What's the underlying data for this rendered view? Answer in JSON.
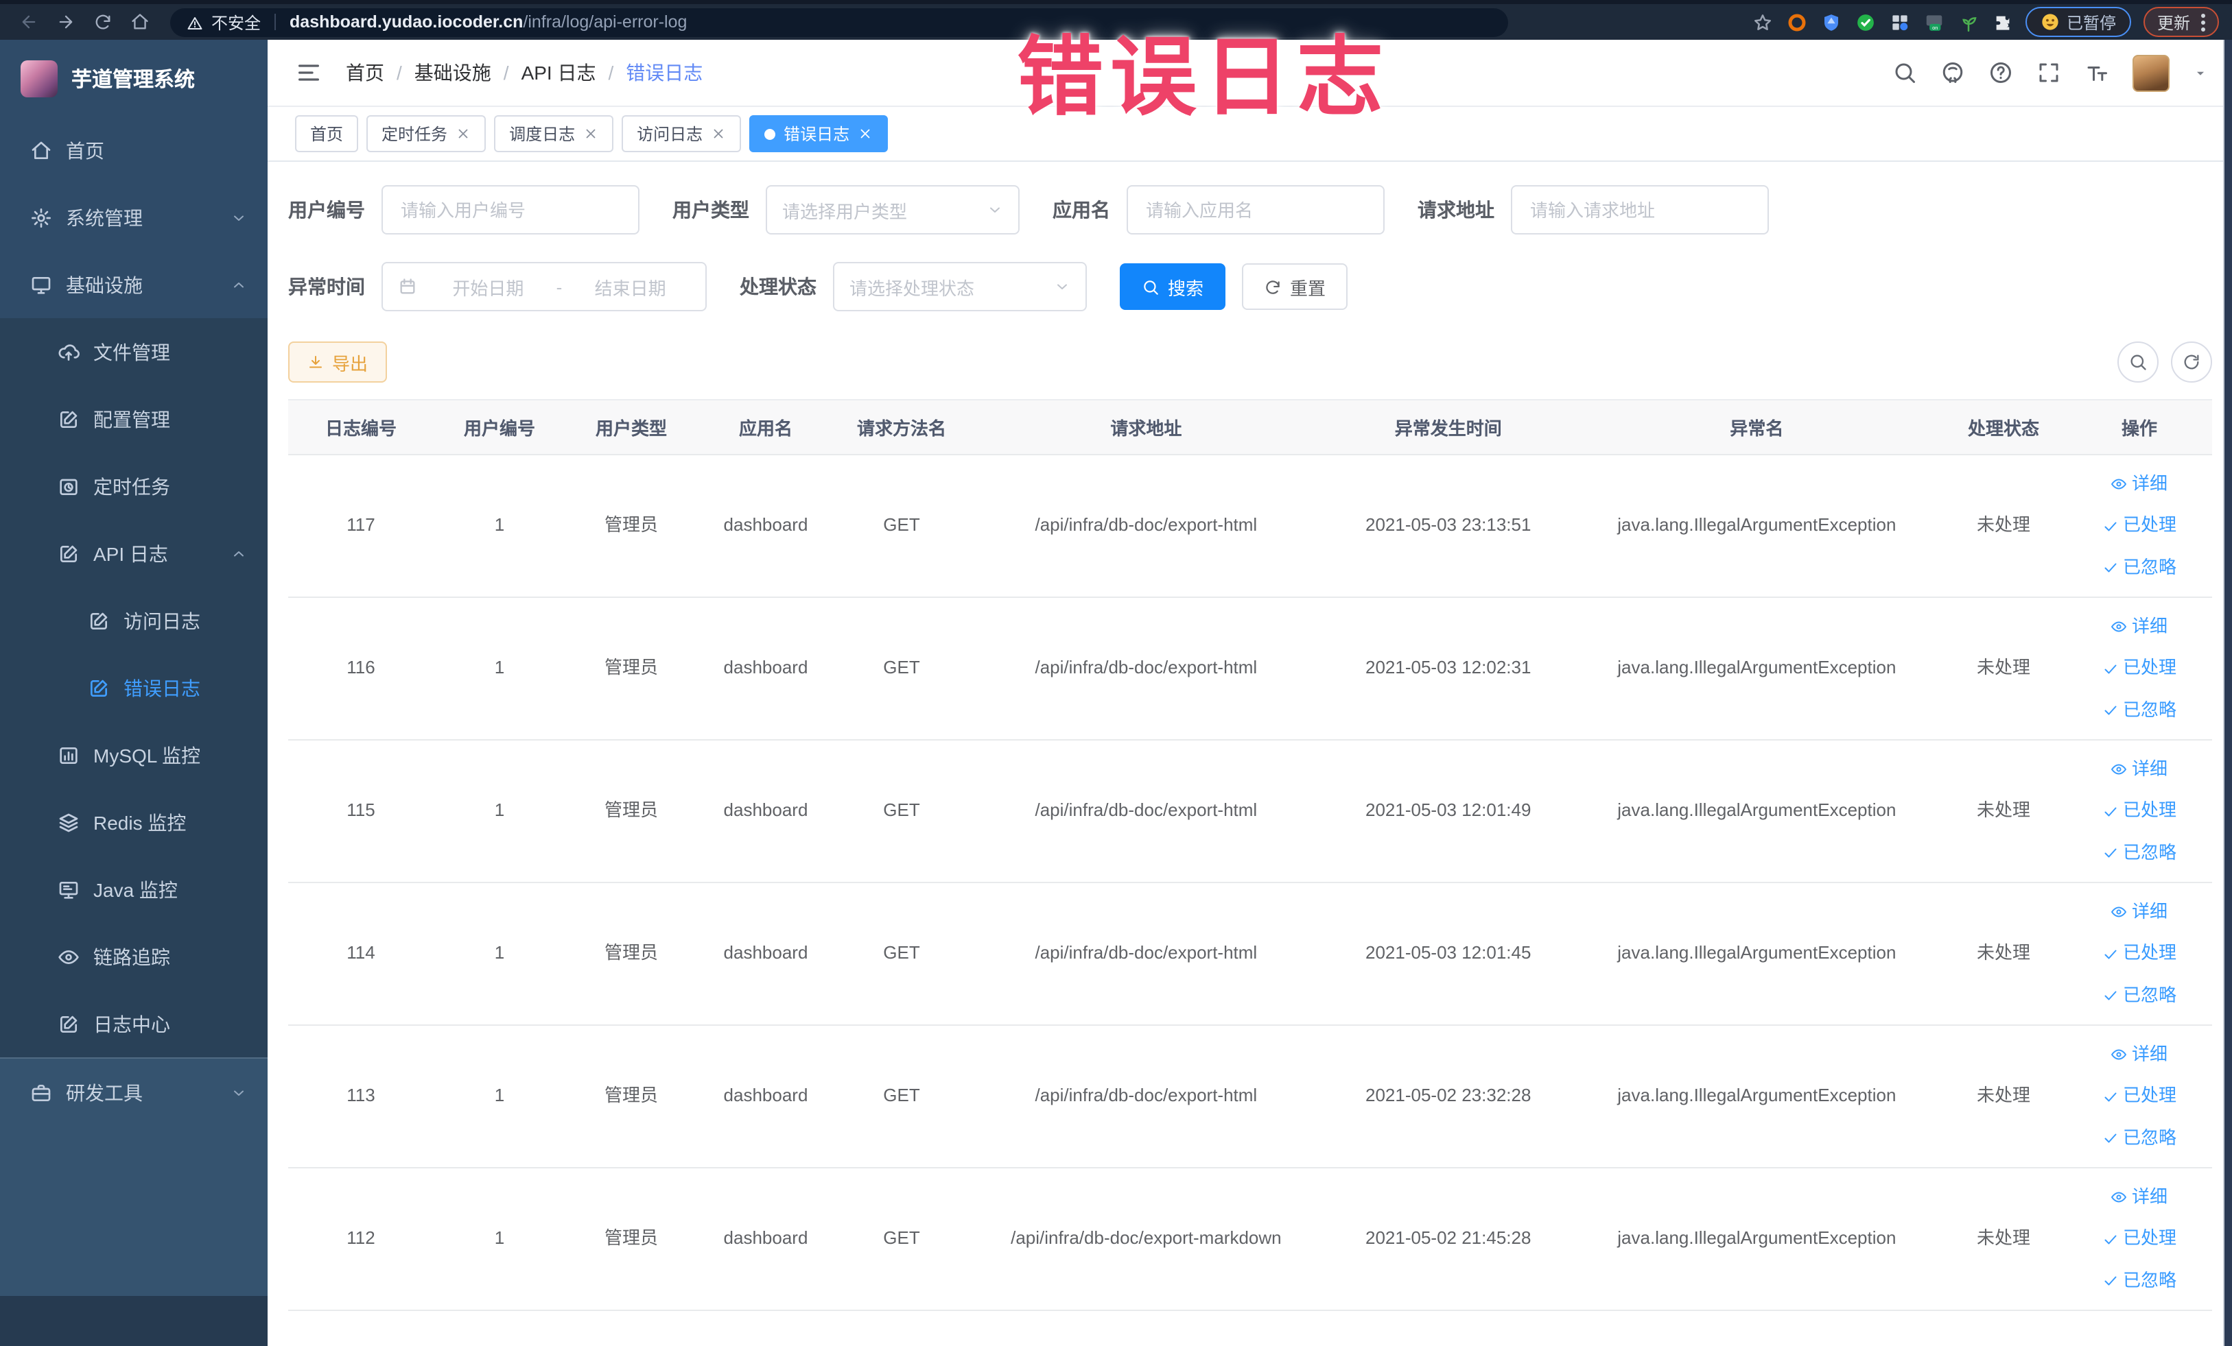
{
  "annotation": {
    "text": "错误日志",
    "color": "#ee4268"
  },
  "browser": {
    "security_label": "不安全",
    "url_host": "dashboard.yudao.iocoder.cn",
    "url_path": "/infra/log/api-error-log",
    "paused_chip_label": "已暂停",
    "update_button_label": "更新",
    "nav_icons": [
      "back-icon",
      "forward-icon",
      "reload-icon",
      "home-icon"
    ],
    "extension_icons": [
      {
        "name": "bookmark-star-icon",
        "color": "#9aa3b2"
      },
      {
        "name": "adblock-ring-icon",
        "color": "#e8710a"
      },
      {
        "name": "shield-icon",
        "color": "#4a8cf7"
      },
      {
        "name": "green-check-extension-icon",
        "color": "#23b34a"
      },
      {
        "name": "apps-grid-icon",
        "color": "#cfd5de"
      },
      {
        "name": "switch-on-icon",
        "color": "#18a05e"
      },
      {
        "name": "sprout-icon",
        "color": "#4caf50"
      },
      {
        "name": "extensions-puzzle-icon",
        "color": "#e8eaed"
      }
    ]
  },
  "sidebar": {
    "title": "芋道管理系统",
    "menu": [
      {
        "key": "home",
        "label": "首页",
        "icon": "home-icon",
        "level": 0
      },
      {
        "key": "system-mgmt",
        "label": "系统管理",
        "icon": "gear-icon",
        "level": 0,
        "chevron": "down"
      },
      {
        "key": "infrastructure",
        "label": "基础设施",
        "icon": "monitor-icon",
        "level": 0,
        "chevron": "up"
      },
      {
        "key": "file-mgmt",
        "label": "文件管理",
        "icon": "cloud-upload-icon",
        "level": 1
      },
      {
        "key": "config-mgmt",
        "label": "配置管理",
        "icon": "edit-square-icon",
        "level": 1
      },
      {
        "key": "scheduled-jobs",
        "label": "定时任务",
        "icon": "timer-icon",
        "level": 1
      },
      {
        "key": "api-log",
        "label": "API 日志",
        "icon": "edit-square-icon",
        "level": 1,
        "chevron": "up"
      },
      {
        "key": "access-log",
        "label": "访问日志",
        "icon": "edit-square-icon",
        "level": 2
      },
      {
        "key": "error-log",
        "label": "错误日志",
        "icon": "edit-square-icon",
        "level": 2,
        "active": true
      },
      {
        "key": "mysql-monitor",
        "label": "MySQL 监控",
        "icon": "bar-chart-icon",
        "level": 1
      },
      {
        "key": "redis-monitor",
        "label": "Redis 监控",
        "icon": "layers-icon",
        "level": 1
      },
      {
        "key": "java-monitor",
        "label": "Java 监控",
        "icon": "display-icon",
        "level": 1
      },
      {
        "key": "trace",
        "label": "链路追踪",
        "icon": "eye-icon",
        "level": 1
      },
      {
        "key": "log-center",
        "label": "日志中心",
        "icon": "edit-square-icon",
        "level": 1
      },
      {
        "key": "dev-tools",
        "label": "研发工具",
        "icon": "toolbox-icon",
        "level": 0,
        "chevron": "down",
        "lower": true
      }
    ]
  },
  "header": {
    "breadcrumb": [
      "首页",
      "基础设施",
      "API 日志",
      "错误日志"
    ],
    "action_icons": [
      "search-icon",
      "github-icon",
      "help-circle-icon",
      "fullscreen-icon",
      "font-size-icon"
    ]
  },
  "tabs": [
    {
      "key": "home",
      "label": "首页",
      "closable": false,
      "active": false
    },
    {
      "key": "scheduled-jobs",
      "label": "定时任务",
      "closable": true,
      "active": false
    },
    {
      "key": "schedule-log",
      "label": "调度日志",
      "closable": true,
      "active": false
    },
    {
      "key": "access-log",
      "label": "访问日志",
      "closable": true,
      "active": false
    },
    {
      "key": "error-log",
      "label": "错误日志",
      "closable": true,
      "active": true
    }
  ],
  "filters": {
    "row1": [
      {
        "key": "user-id",
        "label": "用户编号",
        "type": "input",
        "placeholder": "请输入用户编号"
      },
      {
        "key": "user-type",
        "label": "用户类型",
        "type": "select",
        "placeholder": "请选择用户类型"
      },
      {
        "key": "app-name",
        "label": "应用名",
        "type": "input",
        "placeholder": "请输入应用名"
      },
      {
        "key": "request-url",
        "label": "请求地址",
        "type": "input",
        "placeholder": "请输入请求地址"
      }
    ],
    "row2": [
      {
        "key": "exception-time",
        "label": "异常时间",
        "type": "daterange",
        "start_placeholder": "开始日期",
        "end_placeholder": "结束日期"
      },
      {
        "key": "process-status",
        "label": "处理状态",
        "type": "select",
        "placeholder": "请选择处理状态"
      }
    ],
    "search_label": "搜索",
    "reset_label": "重置"
  },
  "toolbar": {
    "export_label": "导出"
  },
  "table": {
    "columns": [
      "日志编号",
      "用户编号",
      "用户类型",
      "应用名",
      "请求方法名",
      "请求地址",
      "异常发生时间",
      "异常名",
      "处理状态",
      "操作"
    ],
    "row_actions": [
      {
        "key": "detail",
        "label": "详细",
        "icon": "eye-icon"
      },
      {
        "key": "done",
        "label": "已处理",
        "icon": "check-icon"
      },
      {
        "key": "ignored",
        "label": "已忽略",
        "icon": "check-icon"
      }
    ],
    "rows": [
      {
        "id": "117",
        "user_id": "1",
        "user_type": "管理员",
        "app": "dashboard",
        "method": "GET",
        "url": "/api/infra/db-doc/export-html",
        "time": "2021-05-03 23:13:51",
        "exception": "java.lang.IllegalArgumentException",
        "status": "未处理"
      },
      {
        "id": "116",
        "user_id": "1",
        "user_type": "管理员",
        "app": "dashboard",
        "method": "GET",
        "url": "/api/infra/db-doc/export-html",
        "time": "2021-05-03 12:02:31",
        "exception": "java.lang.IllegalArgumentException",
        "status": "未处理"
      },
      {
        "id": "115",
        "user_id": "1",
        "user_type": "管理员",
        "app": "dashboard",
        "method": "GET",
        "url": "/api/infra/db-doc/export-html",
        "time": "2021-05-03 12:01:49",
        "exception": "java.lang.IllegalArgumentException",
        "status": "未处理"
      },
      {
        "id": "114",
        "user_id": "1",
        "user_type": "管理员",
        "app": "dashboard",
        "method": "GET",
        "url": "/api/infra/db-doc/export-html",
        "time": "2021-05-03 12:01:45",
        "exception": "java.lang.IllegalArgumentException",
        "status": "未处理"
      },
      {
        "id": "113",
        "user_id": "1",
        "user_type": "管理员",
        "app": "dashboard",
        "method": "GET",
        "url": "/api/infra/db-doc/export-html",
        "time": "2021-05-02 23:32:28",
        "exception": "java.lang.IllegalArgumentException",
        "status": "未处理"
      },
      {
        "id": "112",
        "user_id": "1",
        "user_type": "管理员",
        "app": "dashboard",
        "method": "GET",
        "url": "/api/infra/db-doc/export-markdown",
        "time": "2021-05-02 21:45:28",
        "exception": "java.lang.IllegalArgumentException",
        "status": "未处理"
      }
    ]
  }
}
